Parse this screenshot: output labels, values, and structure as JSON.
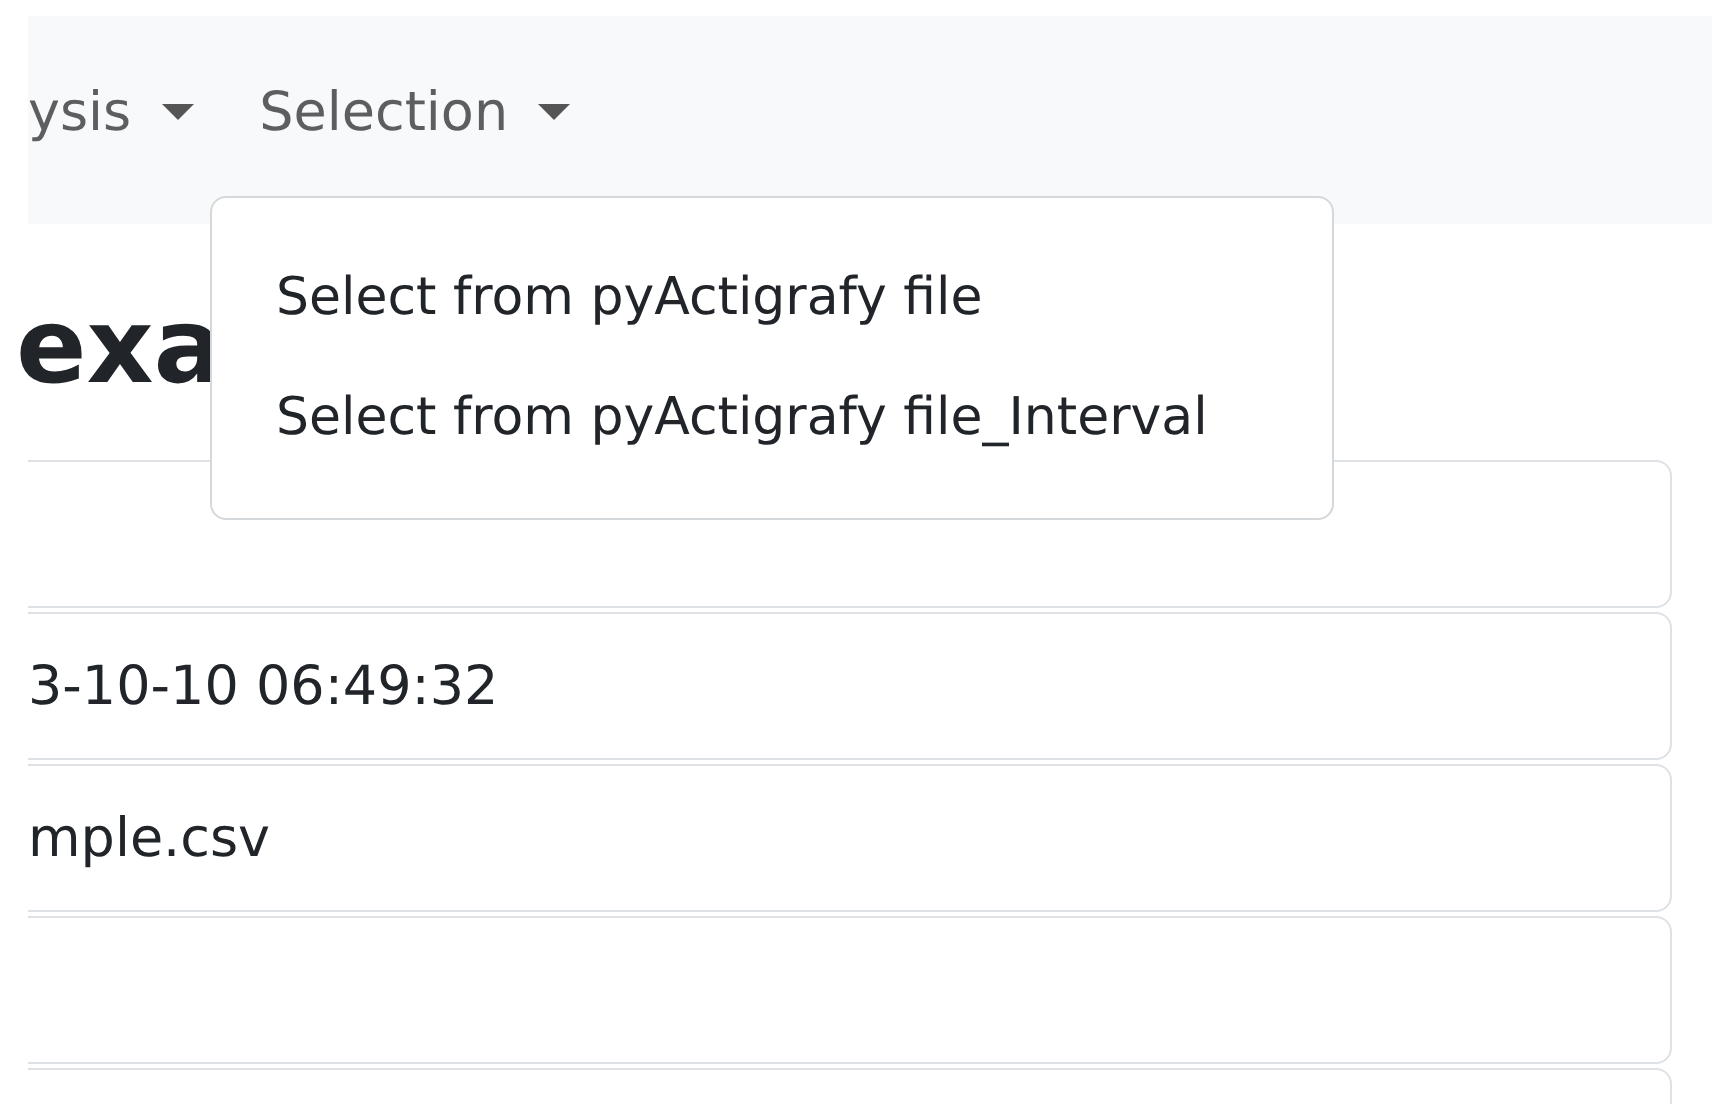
{
  "navbar": {
    "items": [
      {
        "label": "ysis"
      },
      {
        "label": "Selection"
      }
    ]
  },
  "dropdown": {
    "items": [
      "Select from pyActigrafy file",
      "Select from pyActigrafy file_Interval"
    ]
  },
  "heading": "exa",
  "list": [
    {
      "kind": "blank"
    },
    {
      "kind": "text",
      "text": "3-10-10 06:49:32"
    },
    {
      "kind": "text",
      "text": "mple.csv"
    },
    {
      "kind": "blank"
    },
    {
      "kind": "blank"
    }
  ]
}
